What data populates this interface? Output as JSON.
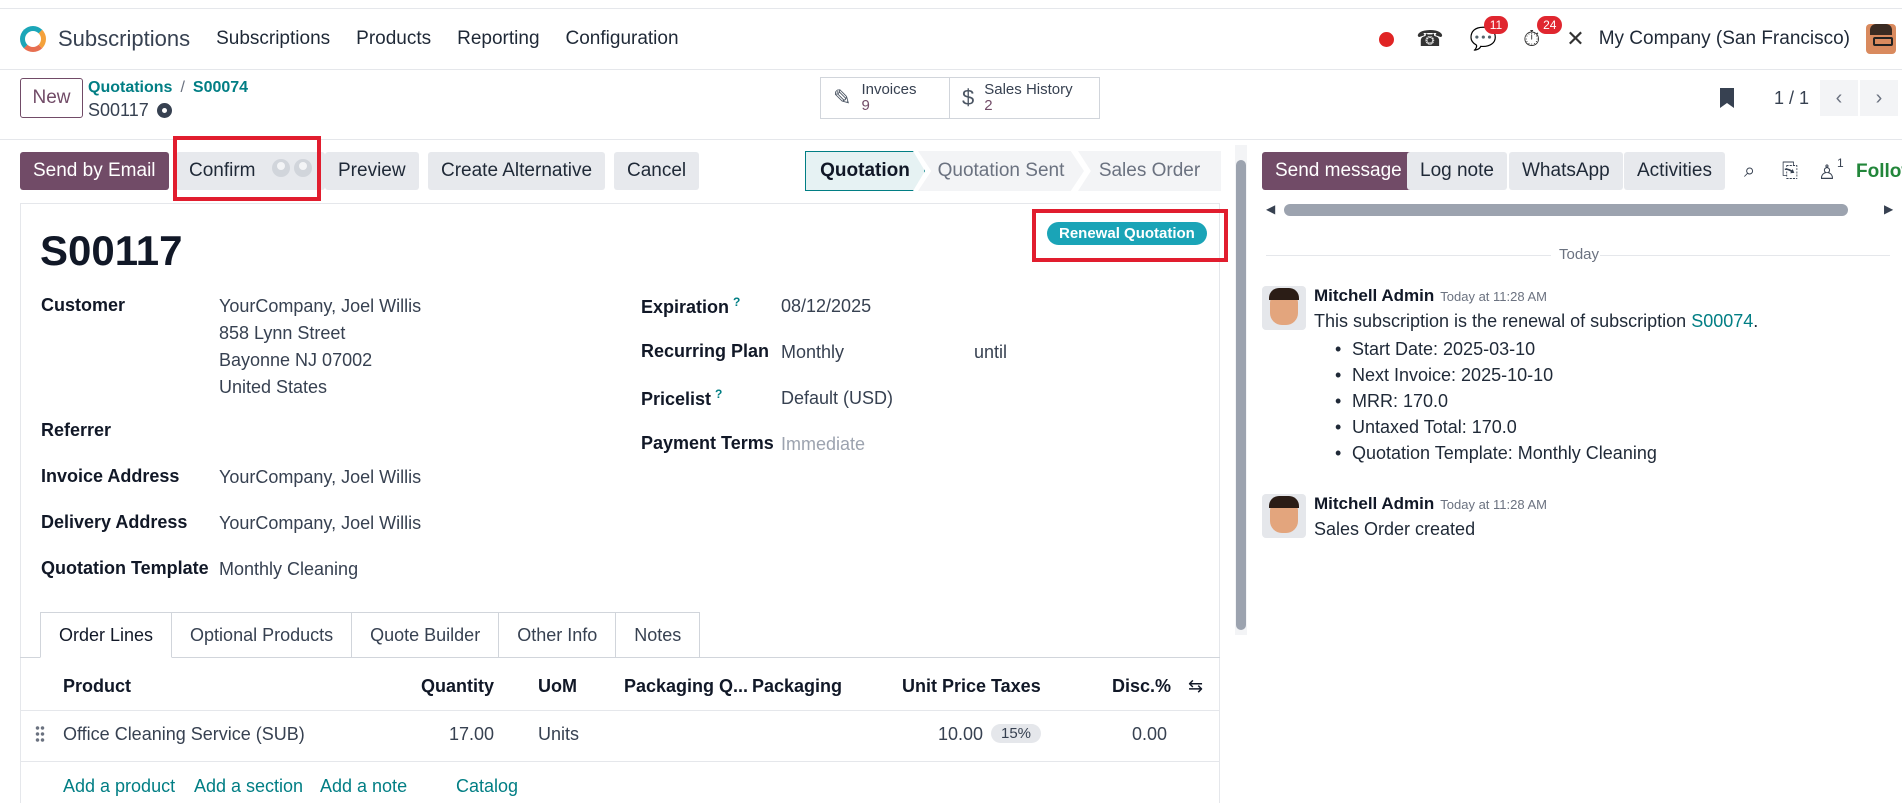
{
  "topnav": {
    "app_name": "Subscriptions",
    "menu": [
      "Subscriptions",
      "Products",
      "Reporting",
      "Configuration"
    ],
    "messages_count": "11",
    "activities_count": "24",
    "company": "My Company (San Francisco)"
  },
  "control": {
    "new_label": "New",
    "breadcrumb": [
      "Quotations",
      "S00074"
    ],
    "record_name": "S00117",
    "smart_buttons": [
      {
        "label": "Invoices",
        "count": "9"
      },
      {
        "label": "Sales History",
        "count": "2"
      }
    ],
    "pager": "1 / 1"
  },
  "statusbar": {
    "buttons": [
      "Send by Email",
      "Confirm",
      "Preview",
      "Create Alternative",
      "Cancel"
    ],
    "stages": [
      "Quotation",
      "Quotation Sent",
      "Sales Order"
    ],
    "active_stage": "Quotation"
  },
  "form": {
    "title": "S00117",
    "badge": "Renewal Quotation",
    "customer_label": "Customer",
    "customer_lines": [
      "YourCompany, Joel Willis",
      "858 Lynn Street",
      "Bayonne NJ 07002",
      "United States"
    ],
    "referrer_label": "Referrer",
    "invoice_address_label": "Invoice Address",
    "invoice_address": "YourCompany, Joel Willis",
    "delivery_address_label": "Delivery Address",
    "delivery_address": "YourCompany, Joel Willis",
    "template_label": "Quotation Template",
    "template": "Monthly Cleaning",
    "expiration_label": "Expiration",
    "expiration": "08/12/2025",
    "recurring_label": "Recurring Plan",
    "recurring": "Monthly",
    "until": "until",
    "pricelist_label": "Pricelist",
    "pricelist": "Default (USD)",
    "payment_terms_label": "Payment Terms",
    "payment_terms_placeholder": "Immediate",
    "help_mark": "?"
  },
  "tabs": [
    "Order Lines",
    "Optional Products",
    "Quote Builder",
    "Other Info",
    "Notes"
  ],
  "table": {
    "headers": [
      "Product",
      "Quantity",
      "UoM",
      "Packaging Q...",
      "Packaging",
      "Unit Price",
      "Taxes",
      "Disc.%"
    ],
    "rows": [
      {
        "product": "Office Cleaning Service (SUB)",
        "quantity": "17.00",
        "uom": "Units",
        "unit_price": "10.00",
        "taxes": "15%",
        "discount": "0.00"
      }
    ],
    "actions": [
      "Add a product",
      "Add a section",
      "Add a note",
      "Catalog"
    ]
  },
  "chatter": {
    "buttons": [
      "Send message",
      "Log note",
      "WhatsApp",
      "Activities"
    ],
    "follow_label": "Follow",
    "followers_count": "1",
    "date_separator": "Today",
    "messages": [
      {
        "author": "Mitchell Admin",
        "time": "Today at 11:28 AM",
        "text": "This subscription is the renewal of subscription",
        "link": "S00074",
        "bullets": [
          "Start Date: 2025-03-10",
          "Next Invoice: 2025-10-10",
          "MRR: 170.0",
          "Untaxed Total: 170.0",
          "Quotation Template: Monthly Cleaning"
        ]
      },
      {
        "author": "Mitchell Admin",
        "time": "Today at 11:28 AM",
        "text": "Sales Order created"
      }
    ]
  }
}
